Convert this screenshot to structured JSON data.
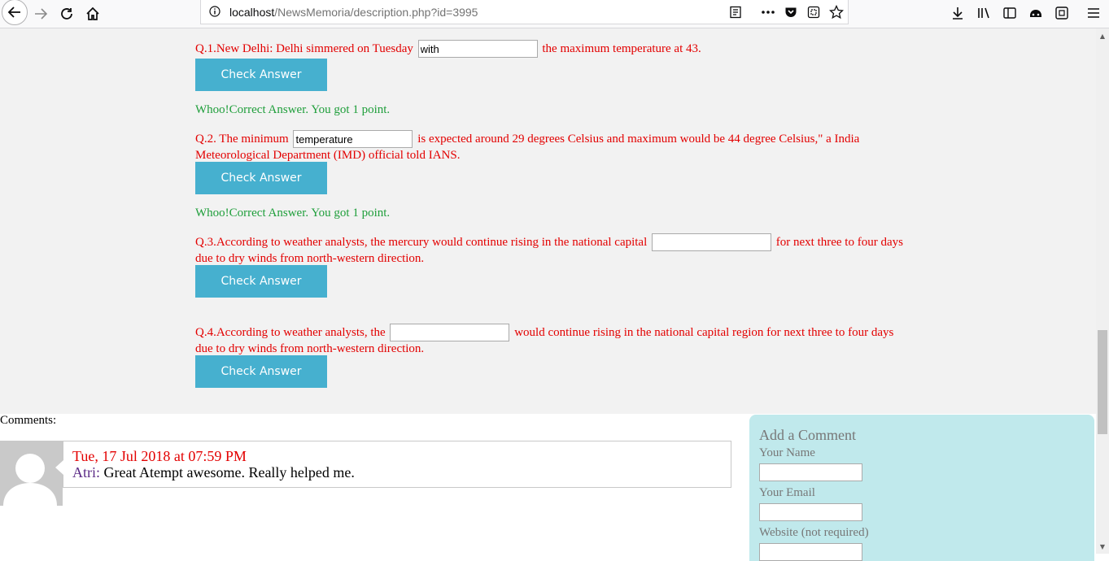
{
  "browser": {
    "url_host": "localhost",
    "url_path": "/NewsMemoria/description.php?id=3995"
  },
  "quiz": {
    "questions": [
      {
        "prefix": "Q.1.New Delhi: Delhi simmered on Tuesday",
        "answer": "with",
        "suffix": "the maximum temperature at 43.",
        "button": "Check Answer",
        "feedback": "Whoo!Correct Answer. You got 1 point."
      },
      {
        "prefix": "Q.2. The minimum",
        "answer": "temperature",
        "suffix": "is expected around 29 degrees Celsius and maximum would be 44 degree Celsius,\" a India Meteorological Department (IMD) official told IANS.",
        "button": "Check Answer",
        "feedback": "Whoo!Correct Answer. You got 1 point."
      },
      {
        "prefix": "Q.3.According to weather analysts, the mercury would continue rising in the national capital",
        "answer": "",
        "suffix": "for next three to four days due to dry winds from north-western direction.",
        "button": "Check Answer",
        "feedback": ""
      },
      {
        "prefix": "Q.4.According to weather analysts, the",
        "answer": "",
        "suffix": "would continue rising in the national capital region for next three to four days due to dry winds from north-western direction.",
        "button": "Check Answer",
        "feedback": ""
      }
    ]
  },
  "comments": {
    "label": "Comments:",
    "items": [
      {
        "date": "Tue, 17 Jul 2018 at 07:59 PM",
        "author": "Atri:",
        "text": "Great Atempt awesome. Really helped me."
      }
    ]
  },
  "add_comment": {
    "title": "Add a Comment",
    "name_label": "Your Name",
    "email_label": "Your Email",
    "website_label": "Website (not required)"
  },
  "colors": {
    "question_text": "#e30000",
    "correct_text": "#1e9e3a",
    "button_bg": "#46b0cf",
    "add_comment_bg": "#c0e9ec"
  }
}
